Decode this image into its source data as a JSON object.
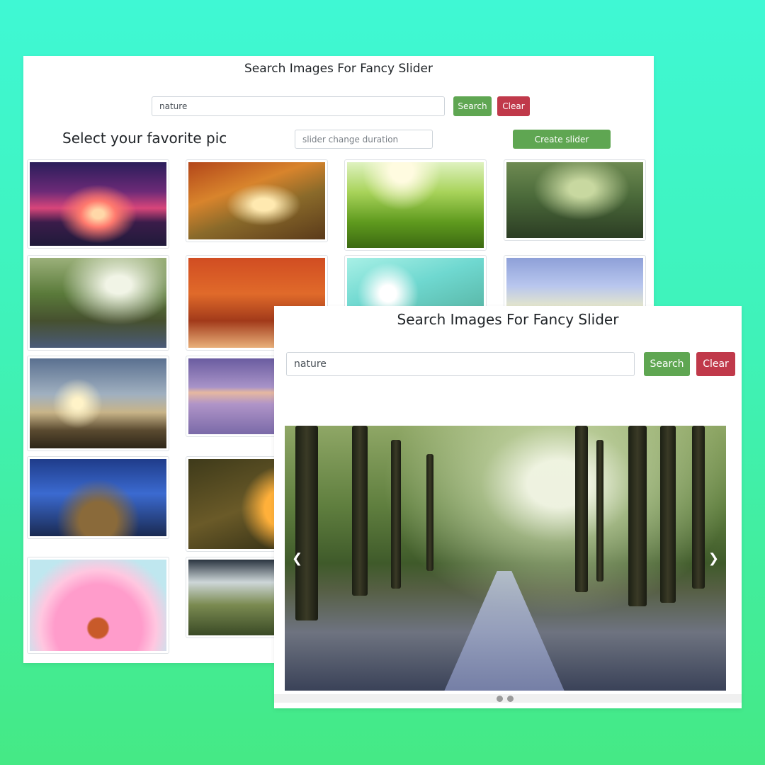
{
  "gallery_page": {
    "title": "Search Images For Fancy Slider",
    "search": {
      "value": "nature"
    },
    "search_button": "Search",
    "clear_button": "Clear",
    "select_heading": "Select your favorite pic",
    "duration": {
      "placeholder": "slider change duration"
    },
    "create_slider_button": "Create slider",
    "thumbnails": [
      {
        "icon": "sunset-tree-image"
      },
      {
        "icon": "autumn-path-image"
      },
      {
        "icon": "sunny-meadow-image"
      },
      {
        "icon": "foggy-forest-image"
      },
      {
        "icon": "forest-road-image"
      },
      {
        "icon": "red-autumn-forest-image"
      },
      {
        "icon": "dandelion-dew-image"
      },
      {
        "icon": "white-butterflies-image"
      },
      {
        "icon": "mountain-sky-image"
      },
      {
        "icon": "purple-sea-image"
      },
      {
        "icon": "blue-butterflies-image"
      },
      {
        "icon": "orange-flower-butterfly-image"
      },
      {
        "icon": "pink-daisy-image"
      },
      {
        "icon": "cloudy-hills-image"
      }
    ]
  },
  "slider_page": {
    "title": "Search Images For Fancy Slider",
    "search": {
      "value": "nature"
    },
    "search_button": "Search",
    "clear_button": "Clear",
    "slider": {
      "current_image": "forest-road-image",
      "prev_icon": "chevron-left-icon",
      "next_icon": "chevron-right-icon",
      "slide_count": 2
    }
  },
  "colors": {
    "background_top": "#3ff8d4",
    "background_bottom": "#45e985",
    "search_button": "#5fa652",
    "clear_button": "#c0394a"
  }
}
